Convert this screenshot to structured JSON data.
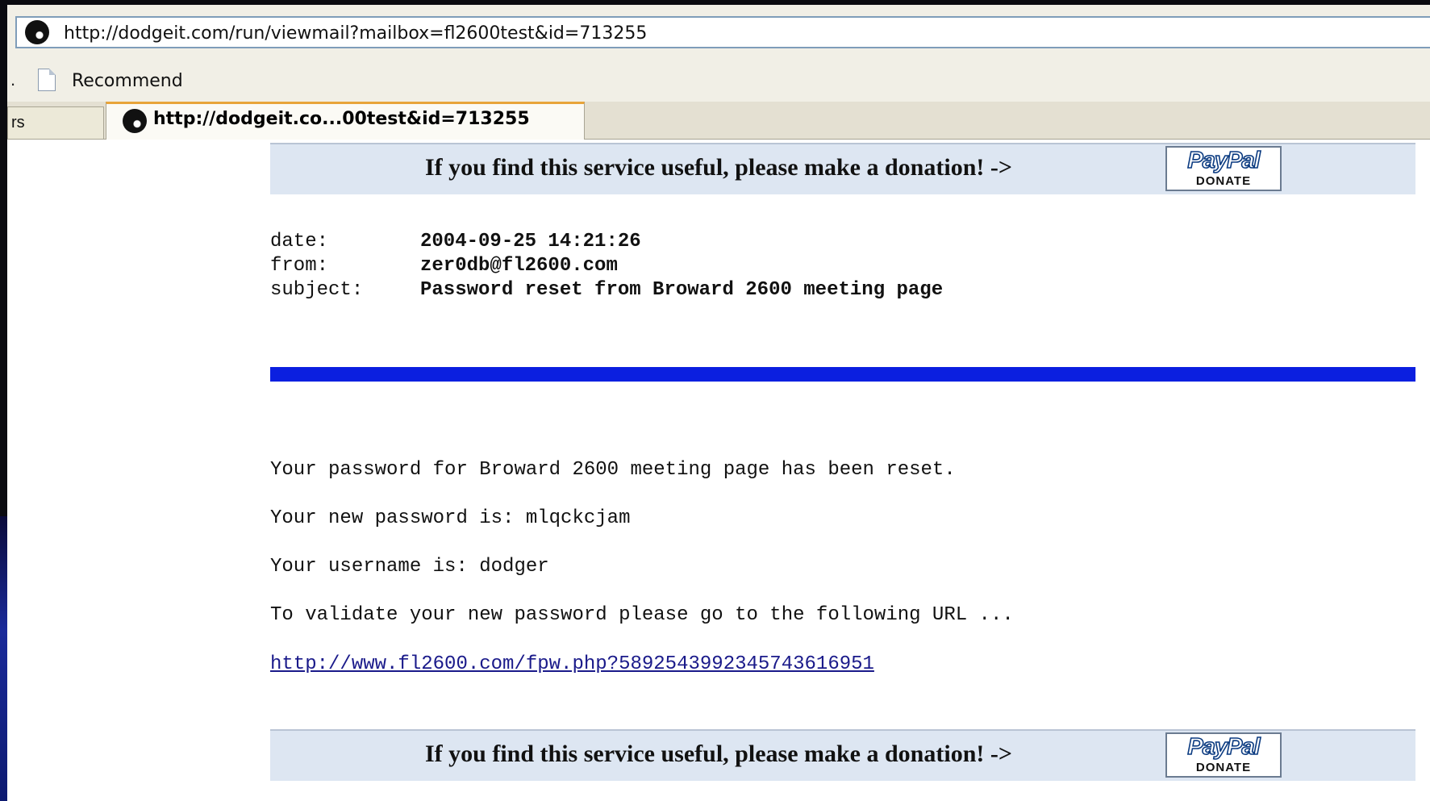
{
  "browser": {
    "address_url": "http://dodgeit.com/run/viewmail?mailbox=fl2600test&id=713255",
    "bookmarks_leading": ".",
    "bookmark_recommend": "Recommend",
    "tab_inactive_label": "rs",
    "tab_active_title": "http://dodgeit.co...00test&id=713255"
  },
  "donation": {
    "text": "If you find this service useful, please make a donation! ->",
    "paypal_logo": "PayPal",
    "paypal_sub": "DONATE"
  },
  "mail_header": {
    "date_label": "date:",
    "date_value": "2004-09-25 14:21:26",
    "from_label": "from:",
    "from_value": "zer0db@fl2600.com",
    "subject_label": "subject:",
    "subject_value": "Password reset from Broward 2600 meeting page"
  },
  "mail_body": {
    "line1": "Your password for Broward 2600 meeting page has been reset.",
    "line2": "Your new password is: mlqckcjam",
    "line3": "Your username is: dodger",
    "line4": "To validate your new password please go to the following URL ...",
    "link": "http://www.fl2600.com/fpw.php?5892543992345743616951"
  },
  "colors": {
    "divider": "#0b1fe0",
    "donate_bar": "#dde6f2",
    "active_tab_accent": "#e8a43a"
  }
}
